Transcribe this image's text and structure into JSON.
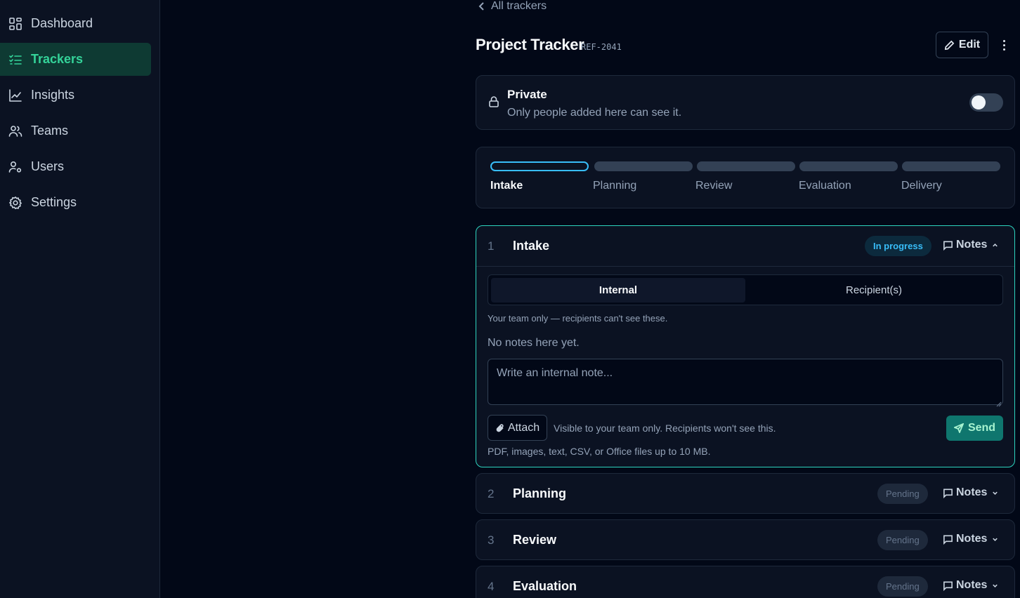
{
  "sidebar": {
    "items": [
      {
        "label": "Dashboard",
        "icon": "dashboard-icon",
        "active": false
      },
      {
        "label": "Trackers",
        "icon": "checklist-icon",
        "active": true
      },
      {
        "label": "Insights",
        "icon": "line-chart-icon",
        "active": false
      },
      {
        "label": "Teams",
        "icon": "users-icon",
        "active": false
      },
      {
        "label": "Users",
        "icon": "user-cog-icon",
        "active": false
      },
      {
        "label": "Settings",
        "icon": "gear-icon",
        "active": false
      }
    ]
  },
  "header": {
    "back_label": "All trackers",
    "title": "Project Tracker",
    "ref": "REF-2041",
    "edit_label": "Edit"
  },
  "privacy": {
    "title": "Private",
    "subtitle": "Only people added here can see it.",
    "enabled": false
  },
  "stepper": {
    "steps": [
      "Intake",
      "Planning",
      "Review",
      "Evaluation",
      "Delivery"
    ],
    "current": 0
  },
  "stages": [
    {
      "number": "1",
      "name": "Intake",
      "status": "In progress",
      "notes_label": "Notes",
      "expanded": true,
      "tabs": [
        "Internal",
        "Recipient(s)"
      ],
      "active_tab": "Internal",
      "help_text": "Your team only — recipients can't see these.",
      "empty_text": "No notes here yet.",
      "input_placeholder": "Write an internal note...",
      "attach_label": "Attach",
      "visibility_note": "Visible to your team only. Recipients won't see this.",
      "send_label": "Send",
      "file_hint": "PDF, images, text, CSV, or Office files up to 10 MB."
    },
    {
      "number": "2",
      "name": "Planning",
      "status": "Pending",
      "notes_label": "Notes",
      "expanded": false
    },
    {
      "number": "3",
      "name": "Review",
      "status": "Pending",
      "notes_label": "Notes",
      "expanded": false
    },
    {
      "number": "4",
      "name": "Evaluation",
      "status": "Pending",
      "notes_label": "Notes",
      "expanded": false
    }
  ],
  "colors": {
    "accent": "#34d399",
    "teal_border": "#2dd4bf",
    "progress_blue": "#38bdf8",
    "send_bg": "#0f766e"
  }
}
